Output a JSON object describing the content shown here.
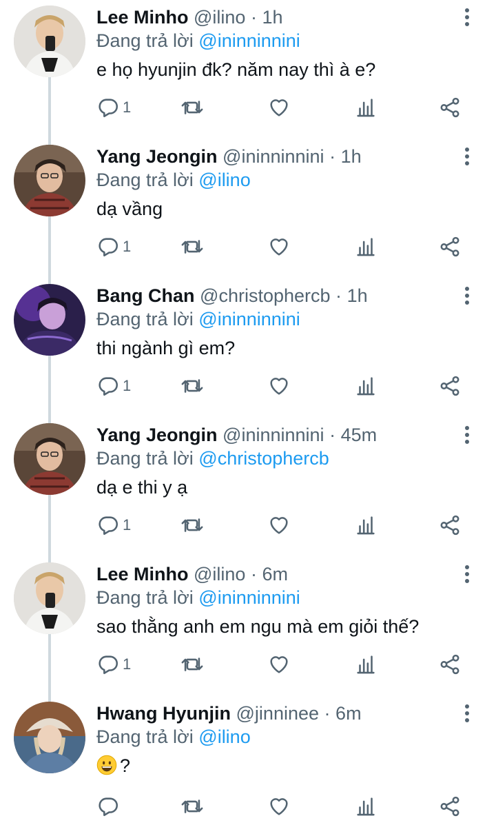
{
  "replying_prefix": "Đang trả lời",
  "tweets": [
    {
      "name": "Lee Minho",
      "handle": "@ilino",
      "time": "1h",
      "replying_to": "@ininninnini",
      "text": "e họ hyunjin đk? năm nay thì à e?",
      "reply_count": "1",
      "avatar": "lee-minho"
    },
    {
      "name": "Yang Jeongin",
      "handle": "@ininninnini",
      "time": "1h",
      "replying_to": "@ilino",
      "text": "dạ vầng",
      "reply_count": "1",
      "avatar": "yang-jeongin"
    },
    {
      "name": "Bang Chan",
      "handle": "@christophercb",
      "time": "1h",
      "replying_to": "@ininninnini",
      "text": "thi ngành gì em?",
      "reply_count": "1",
      "avatar": "bang-chan"
    },
    {
      "name": "Yang Jeongin",
      "handle": "@ininninnini",
      "time": "45m",
      "replying_to": "@christophercb",
      "text": "dạ e thi y ạ",
      "reply_count": "1",
      "avatar": "yang-jeongin"
    },
    {
      "name": "Lee Minho",
      "handle": "@ilino",
      "time": "6m",
      "replying_to": "@ininninnini",
      "text": "sao thằng anh em ngu mà em giỏi thế?",
      "reply_count": "1",
      "avatar": "lee-minho"
    },
    {
      "name": "Hwang Hyunjin",
      "handle": "@jinninee",
      "time": "6m",
      "replying_to": "@ilino",
      "text": "?",
      "text_emoji": "grinning-face-emoji",
      "reply_count": "",
      "avatar": "hwang-hyunjin"
    }
  ],
  "icons": {
    "reply": "reply-icon",
    "retweet": "retweet-icon",
    "like": "heart-icon",
    "analytics": "analytics-icon",
    "share": "share-icon",
    "more": "more-vertical-icon"
  },
  "colors": {
    "text": "#0f1419",
    "secondary": "#536471",
    "mention": "#1d9bf0",
    "thread_line": "#cfd9de"
  }
}
